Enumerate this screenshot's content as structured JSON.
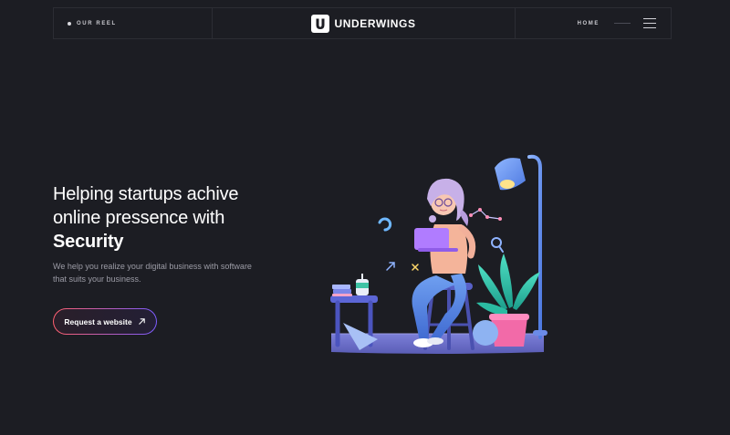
{
  "header": {
    "reel_label": "OUR REEL",
    "logo_letter": "U",
    "logo_text": "UNDERWINGS",
    "nav_home": "HOME",
    "menu_icon": "hamburger-menu-icon"
  },
  "hero": {
    "title_line1": "Helping startups achive",
    "title_line2": "online pressence with",
    "title_strong": "Security",
    "subtitle": "We help you realize your digital business  with software that suits your business.",
    "cta_label": "Request a website",
    "cta_icon": "arrow-up-right-icon"
  },
  "colors": {
    "background": "#1c1d23",
    "border": "#2c2d34",
    "cta_gradient_start": "#ff5f6d",
    "cta_gradient_end": "#7b5cff"
  }
}
